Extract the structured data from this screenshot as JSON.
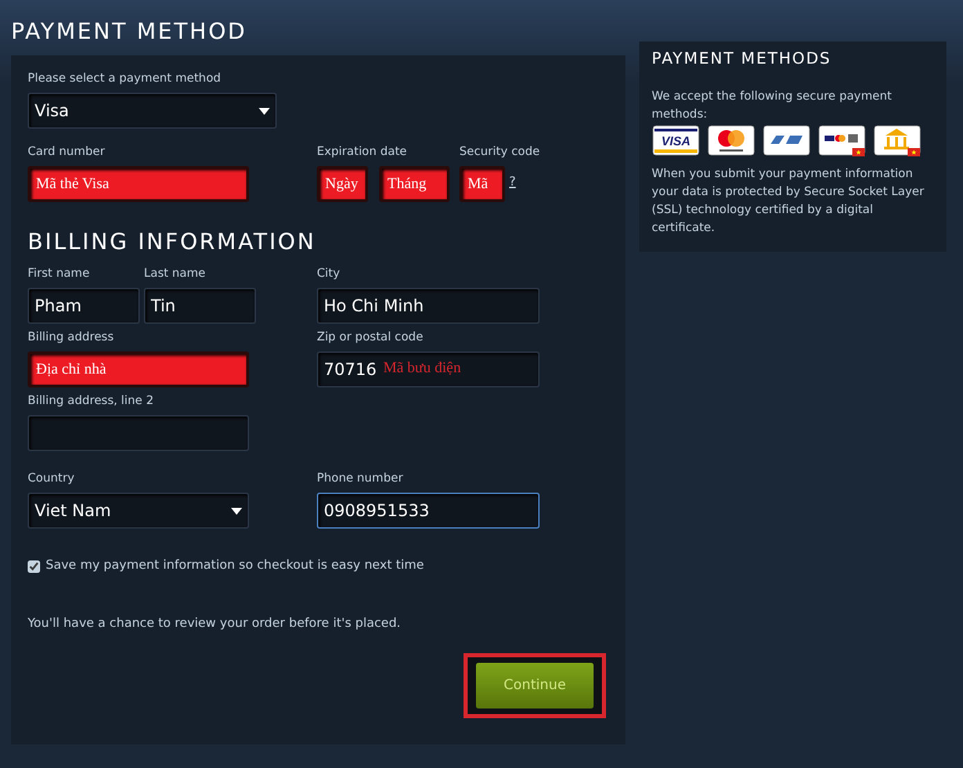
{
  "page_title": "PAYMENT METHOD",
  "payment_select": {
    "label": "Please select a payment method",
    "value": "Visa"
  },
  "card_number": {
    "label": "Card number",
    "value": "Mã thẻ Visa",
    "highlighted": true
  },
  "expiration": {
    "label": "Expiration date",
    "fields": [
      {
        "value": "Ngày",
        "highlighted": true
      },
      {
        "value": "Tháng",
        "highlighted": true
      }
    ]
  },
  "security_code": {
    "label": "Security code",
    "value": "Mã",
    "highlighted": true,
    "help": "?"
  },
  "billing": {
    "heading": "BILLING INFORMATION",
    "first_name": {
      "label": "First name",
      "value": "Pham",
      "highlighted": false
    },
    "last_name": {
      "label": "Last name",
      "value": "Tin",
      "highlighted": false
    },
    "city": {
      "label": "City",
      "value": "Ho Chi Minh",
      "highlighted": false
    },
    "billing_address": {
      "label": "Billing address",
      "value": "Địa chỉ nhà",
      "highlighted": true
    },
    "zip": {
      "label": "Zip or postal code",
      "value": "70716",
      "highlighted": false,
      "note": "Mã bưu điện"
    },
    "billing_address_2": {
      "label": "Billing address, line 2",
      "highlighted": false
    },
    "country": {
      "label": "Country",
      "value": "Viet Nam"
    },
    "phone": {
      "label": "Phone number",
      "value": "0908951533",
      "highlighted": false,
      "focused": true
    }
  },
  "save_info": {
    "label": "Save my payment information so checkout is easy next time",
    "checked": true
  },
  "review_note": "You'll have a chance to review your order before it's placed.",
  "continue_button": {
    "label": "Continue",
    "highlighted": true
  },
  "sidebar": {
    "title": "PAYMENT METHODS",
    "intro": "We accept the following secure payment methods:",
    "cards": [
      {
        "kind": "visa",
        "label": "VISA"
      },
      {
        "kind": "mastercard"
      },
      {
        "kind": "napas"
      },
      {
        "kind": "domestic-cards"
      },
      {
        "kind": "bank"
      }
    ],
    "notice": "When you submit your payment information your data is protected by Secure Socket Layer (SSL) technology certified by a digital certificate."
  }
}
